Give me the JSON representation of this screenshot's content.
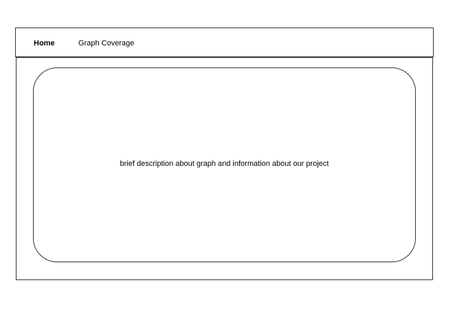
{
  "nav": {
    "home_label": "Home",
    "coverage_label": "Graph Coverage"
  },
  "main": {
    "description": "brief description about graph and information about our project"
  }
}
